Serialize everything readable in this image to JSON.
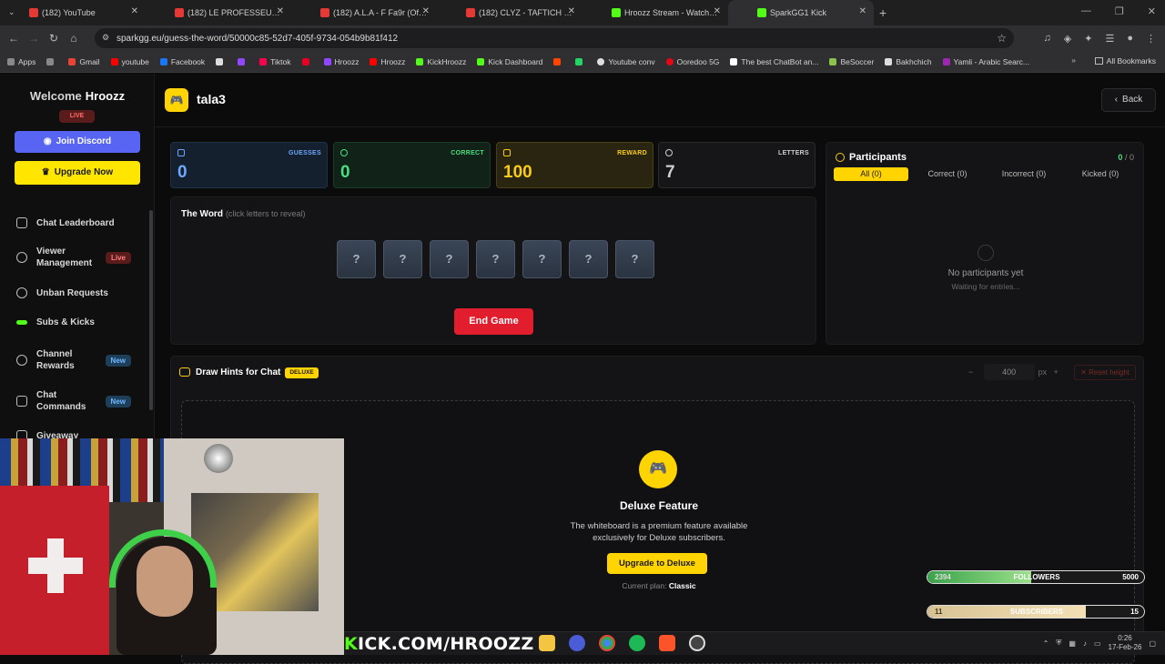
{
  "browser": {
    "tabs": [
      {
        "title": "(182) YouTube"
      },
      {
        "title": "(182) LE PROFESSEUR 👨‍🏫 Ep 04"
      },
      {
        "title": "(182) A.L.A - F Fa9r (Official Au"
      },
      {
        "title": "(182) CLYZ - TAFTICH FEAT. MA"
      },
      {
        "title": "Hroozz Stream - Watch Live on"
      },
      {
        "title": "SparkGG1 Kick"
      }
    ],
    "url": "sparkgg.eu/guess-the-word/50000c85-52d7-405f-9734-054b9b81f412",
    "bookmarks": [
      "Apps",
      "Gmail",
      "youtube",
      "Facebook",
      "",
      "",
      "",
      "Tiktok",
      "",
      "",
      "Hroozz",
      "Hroozz",
      "KickHroozz",
      "Kick Dashboard",
      "",
      "",
      "Youtube conv",
      "Ooredoo 5G",
      "The best ChatBot an...",
      "BeSoccer",
      "Bakhchich",
      "Yamli - Arabic Searc..."
    ],
    "all_bookmarks": "All Bookmarks"
  },
  "sidebar": {
    "welcome": "Welcome",
    "username": "Hroozz",
    "live": "LIVE",
    "join_discord": "Join Discord",
    "upgrade_now": "Upgrade Now",
    "items": [
      {
        "label": "Chat Leaderboard",
        "badge": ""
      },
      {
        "label": "Viewer Management",
        "badge": "Live"
      },
      {
        "label": "Unban Requests",
        "badge": ""
      },
      {
        "label": "Subs & Kicks",
        "badge": ""
      },
      {
        "label": "Channel Rewards",
        "badge": "New"
      },
      {
        "label": "Chat Commands",
        "badge": "New"
      },
      {
        "label": "Giveaway",
        "badge": ""
      }
    ]
  },
  "game": {
    "title": "tala3",
    "back": "Back",
    "stats": {
      "guesses_label": "GUESSES",
      "guesses": "0",
      "correct_label": "CORRECT",
      "correct": "0",
      "reward_label": "REWARD",
      "reward": "100",
      "letters_label": "LETTERS",
      "letters": "7"
    },
    "word_title": "The Word",
    "word_sub": "(click letters to reveal)",
    "tiles": [
      "?",
      "?",
      "?",
      "?",
      "?",
      "?",
      "?"
    ],
    "end_game": "End Game"
  },
  "participants": {
    "title": "Participants",
    "count_correct": "0",
    "separator": "/",
    "count_total": "0",
    "tabs": [
      "All (0)",
      "Correct (0)",
      "Incorrect (0)",
      "Kicked (0)"
    ],
    "empty_title": "No participants yet",
    "empty_sub": "Waiting for entries..."
  },
  "draw": {
    "title": "Draw Hints for Chat",
    "tag": "DELUXE",
    "zoom_minus": "−",
    "zoom_value": "400",
    "zoom_unit": "px",
    "zoom_plus": "+",
    "reset": "Reset height",
    "feature_title": "Deluxe Feature",
    "feature_desc": "The whiteboard is a premium feature available exclusively for Deluxe subscribers.",
    "upgrade_button": "Upgrade to Deluxe",
    "plan_label": "Current plan:",
    "plan_value": "Classic"
  },
  "overlay": {
    "kick_prefix": "K",
    "kick_rest": "ICK.COM/HROOZZ",
    "followers": {
      "current": "2394",
      "label": "FOLLOWERS",
      "goal": "5000",
      "progress": 0.48
    },
    "subscribers": {
      "current": "11",
      "label": "SUBSCRIBERS",
      "goal": "15",
      "progress": 0.73
    }
  },
  "taskbar": {
    "time": "0:26",
    "date": "17-Feb-26"
  },
  "colors": {
    "accent_yellow": "#ffd400",
    "discord": "#5865f2",
    "end_red": "#e11d2e",
    "kick_green": "#53fc18"
  }
}
